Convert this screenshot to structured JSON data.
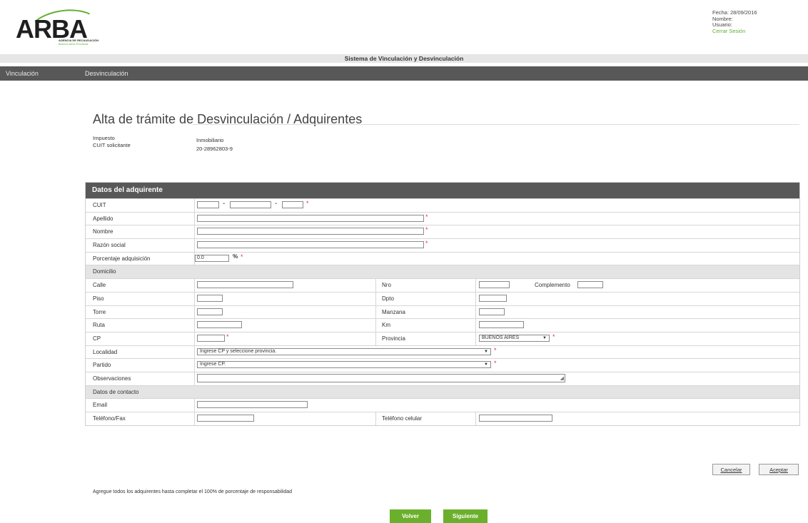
{
  "header": {
    "logo_text": "ARBA",
    "logo_sub1": "AGENCIA DE RECAUDACIÓN",
    "logo_sub2": "Buenos Aires Provincia",
    "fecha": "Fecha: 28/09/2016",
    "nombre": "Nombre:",
    "usuario": "Usuario:",
    "cerrar_sesion": "Cerrar Sesión",
    "system_title": "Sistema de Vinculación y Desvinculación"
  },
  "nav": {
    "items": [
      {
        "label": "Vinculación"
      },
      {
        "label": "Desvinculación"
      }
    ]
  },
  "page": {
    "title": "Alta de trámite de Desvinculación / Adquirentes",
    "impuesto_label": "Impuesto",
    "impuesto_value": "Inmobiliario",
    "cuit_label": "CUIT solicitante",
    "cuit_value": "20-28962803-9"
  },
  "form": {
    "header": "Datos del adquirente",
    "cuit": "CUIT",
    "apellido": "Apellido",
    "nombre": "Nombre",
    "razon_social": "Razón social",
    "porcentaje": "Porcentaje adquisición",
    "porcentaje_value": "0.0",
    "porcentaje_symbol": "%",
    "domicilio": "Domicilio",
    "calle": "Calle",
    "nro": "Nro",
    "complemento": "Complemento",
    "piso": "Piso",
    "dpto": "Dpto",
    "torre": "Torre",
    "manzana": "Manzana",
    "ruta": "Ruta",
    "km": "Km",
    "cp": "CP",
    "provincia": "Provincia",
    "provincia_value": "BUENOS AIRES",
    "localidad": "Localidad",
    "localidad_value": "Ingrese CP y seleccione provincia.",
    "partido": "Partido",
    "partido_value": "Ingrese CP.",
    "observaciones": "Observaciones",
    "datos_contacto": "Datos de contacto",
    "email": "Email",
    "telefono": "Teléfono/Fax",
    "telefono_celular": "Teléfono celular",
    "required_mark": "*",
    "dash": "-"
  },
  "actions": {
    "cancelar": "Cancelar",
    "aceptar": "Aceptar",
    "note": "Agregue todos los adquirentes hasta completar el 100% de porcentaje de responsabilidad",
    "volver": "Volver",
    "siguiente": "Siguiente"
  },
  "colors": {
    "brand_green": "#6bb02c",
    "nav_gray": "#585858",
    "required_red": "#e0344b"
  }
}
